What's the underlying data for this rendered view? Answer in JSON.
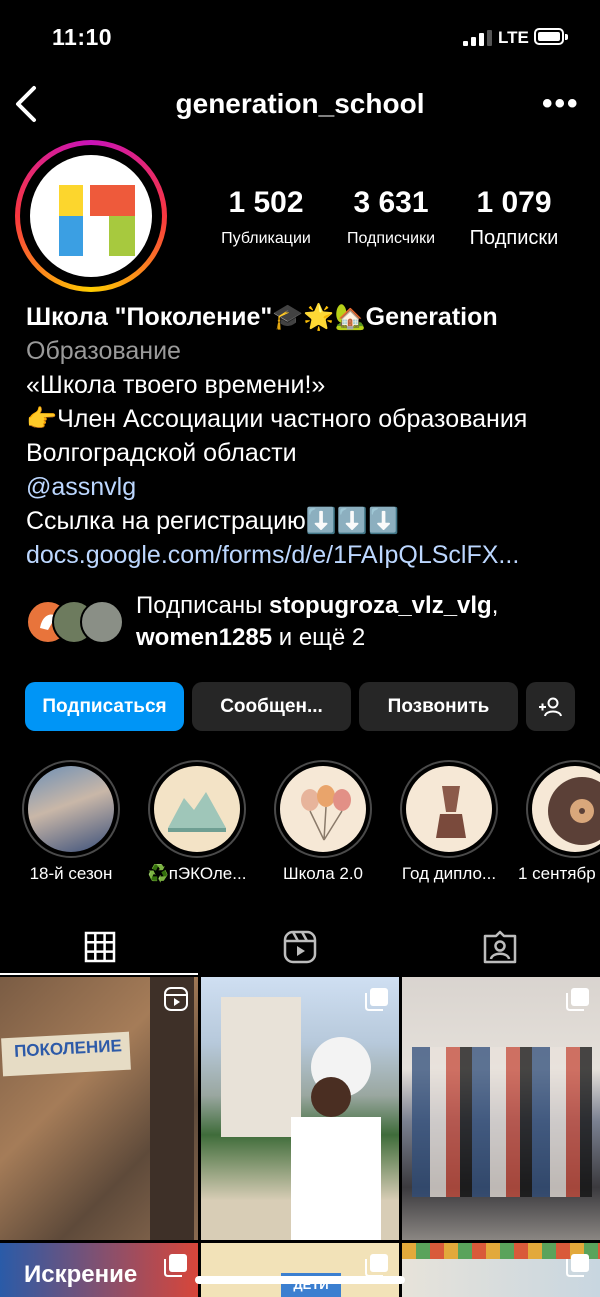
{
  "status": {
    "time": "11:10",
    "network": "LTE"
  },
  "header": {
    "username": "generation_school"
  },
  "stats": [
    {
      "value": "1 502",
      "label": "Публикации"
    },
    {
      "value": "3 631",
      "label": "Подписчики"
    },
    {
      "value": "1 079",
      "label": "Подписки"
    }
  ],
  "bio": {
    "name": "Школа \"Поколение\"🎓🌟🏡Generation",
    "category": "Образование",
    "line1": "«Школа твоего времени!»",
    "line2": "👉Член Ассоциации частного образования Волгоградской области",
    "mention": "@assnvlg",
    "line3": "Ссылка на регистрацию⬇️⬇️⬇️",
    "link": "docs.google.com/forms/d/e/1FAIpQLSclFX..."
  },
  "followed_by": {
    "prefix": "Подписаны ",
    "user1": "stopugroza_vlz_vlg",
    "sep": ", ",
    "user2": "women1285",
    "suffix": " и ещё 2"
  },
  "buttons": {
    "follow": "Подписаться",
    "message": "Сообщен...",
    "call": "Позвонить"
  },
  "highlights": [
    {
      "label": "18-й сезон"
    },
    {
      "label": "♻️пЭКОле..."
    },
    {
      "label": "Школа 2.0"
    },
    {
      "label": "Год дипло..."
    },
    {
      "label": "1 сентябр"
    }
  ],
  "tabs": [
    "grid",
    "reels",
    "tagged"
  ],
  "posts": [
    {
      "text": "ПОКОЛЕНИЕ"
    },
    {
      "text": ""
    },
    {
      "text": ""
    },
    {
      "text": "Искрение"
    },
    {
      "text": "ДЕТИ"
    },
    {
      "text": ""
    }
  ],
  "colors": {
    "primary_button": "#0095f6",
    "secondary_button": "#262626",
    "link": "#bcd7ff",
    "muted": "#9a9a9a"
  }
}
